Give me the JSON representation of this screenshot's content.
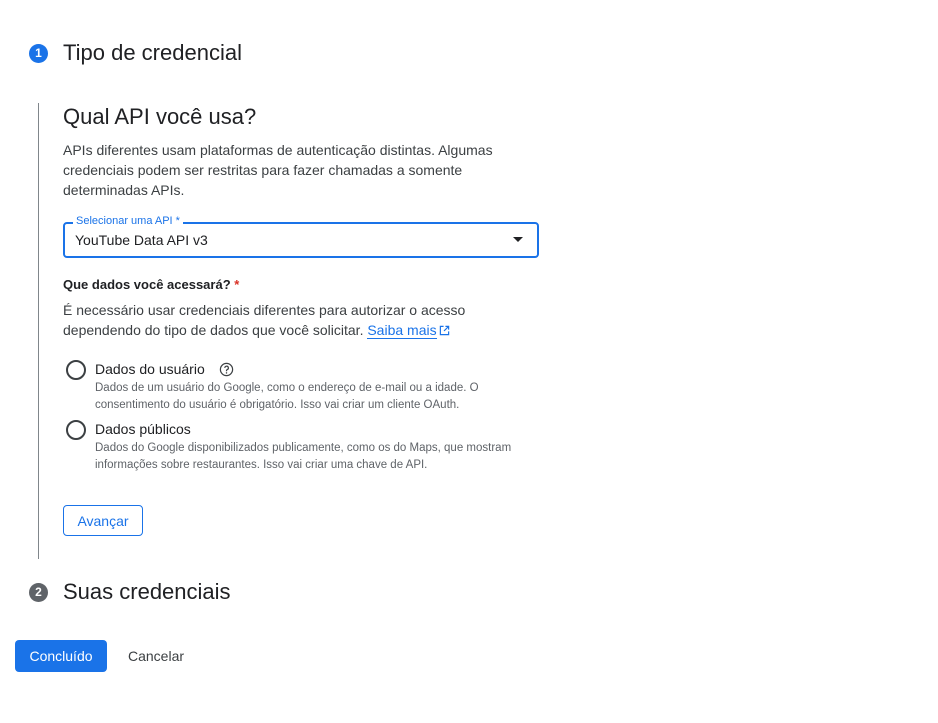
{
  "steps": [
    {
      "number": "1",
      "title": "Tipo de credencial",
      "color": "#1a73e8"
    },
    {
      "number": "2",
      "title": "Suas credenciais",
      "color": "#5f6368"
    }
  ],
  "api_section": {
    "title": "Qual API você usa?",
    "description": "APIs diferentes usam plataformas de autenticação distintas. Algumas credenciais podem ser restritas para fazer chamadas a somente determinadas APIs.",
    "select": {
      "label": "Selecionar uma API *",
      "value": "YouTube Data API v3"
    }
  },
  "data_section": {
    "label": "Que dados você acessará?",
    "required_mark": "*",
    "description": "É necessário usar credenciais diferentes para autorizar o acesso dependendo do tipo de dados que você solicitar.",
    "link_text": "Saiba mais",
    "options": [
      {
        "title": "Dados do usuário",
        "subtitle": "Dados de um usuário do Google, como o endereço de e-mail ou a idade. O consentimento do usuário é obrigatório. Isso vai criar um cliente OAuth.",
        "selected": false
      },
      {
        "title": "Dados públicos",
        "subtitle": "Dados do Google disponibilizados publicamente, como os do Maps, que mostram informações sobre restaurantes. Isso vai criar uma chave de API.",
        "selected": false
      }
    ],
    "next_button": "Avançar"
  },
  "footer": {
    "done_button": "Concluído",
    "cancel_button": "Cancelar"
  },
  "colors": {
    "accent": "#1a73e8",
    "required": "#d93025"
  }
}
